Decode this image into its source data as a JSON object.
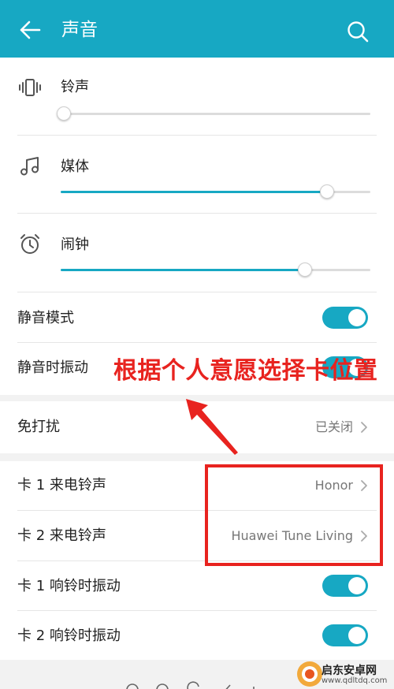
{
  "header": {
    "title": "声音",
    "back_icon": "arrow-left-icon",
    "search_icon": "search-icon",
    "color": "#17a8c3"
  },
  "volume": {
    "ringtone": {
      "label": "铃声",
      "icon": "vibrate-icon",
      "level": 0.01
    },
    "media": {
      "label": "媒体",
      "icon": "music-note-icon",
      "level": 0.86
    },
    "alarm": {
      "label": "闹钟",
      "icon": "alarm-clock-icon",
      "level": 0.79
    }
  },
  "toggles": {
    "silent_mode": {
      "label": "静音模式",
      "on": true
    },
    "silent_vibrate": {
      "label": "静音时振动",
      "on": true
    }
  },
  "do_not_disturb": {
    "label": "免打扰",
    "value": "已关闭"
  },
  "sim": {
    "sim1_ringtone": {
      "label": "卡 1 来电铃声",
      "value": "Honor"
    },
    "sim2_ringtone": {
      "label": "卡 2 来电铃声",
      "value": "Huawei Tune Living"
    },
    "sim1_vibrate": {
      "label": "卡 1 响铃时振动",
      "on": true
    },
    "sim2_vibrate": {
      "label": "卡 2 响铃时振动",
      "on": true
    }
  },
  "annotation": {
    "text": "根据个人意愿选择卡位置",
    "color": "#e8231f"
  },
  "watermark": {
    "title": "启东安卓网",
    "url": "www.qdltdq.com"
  }
}
